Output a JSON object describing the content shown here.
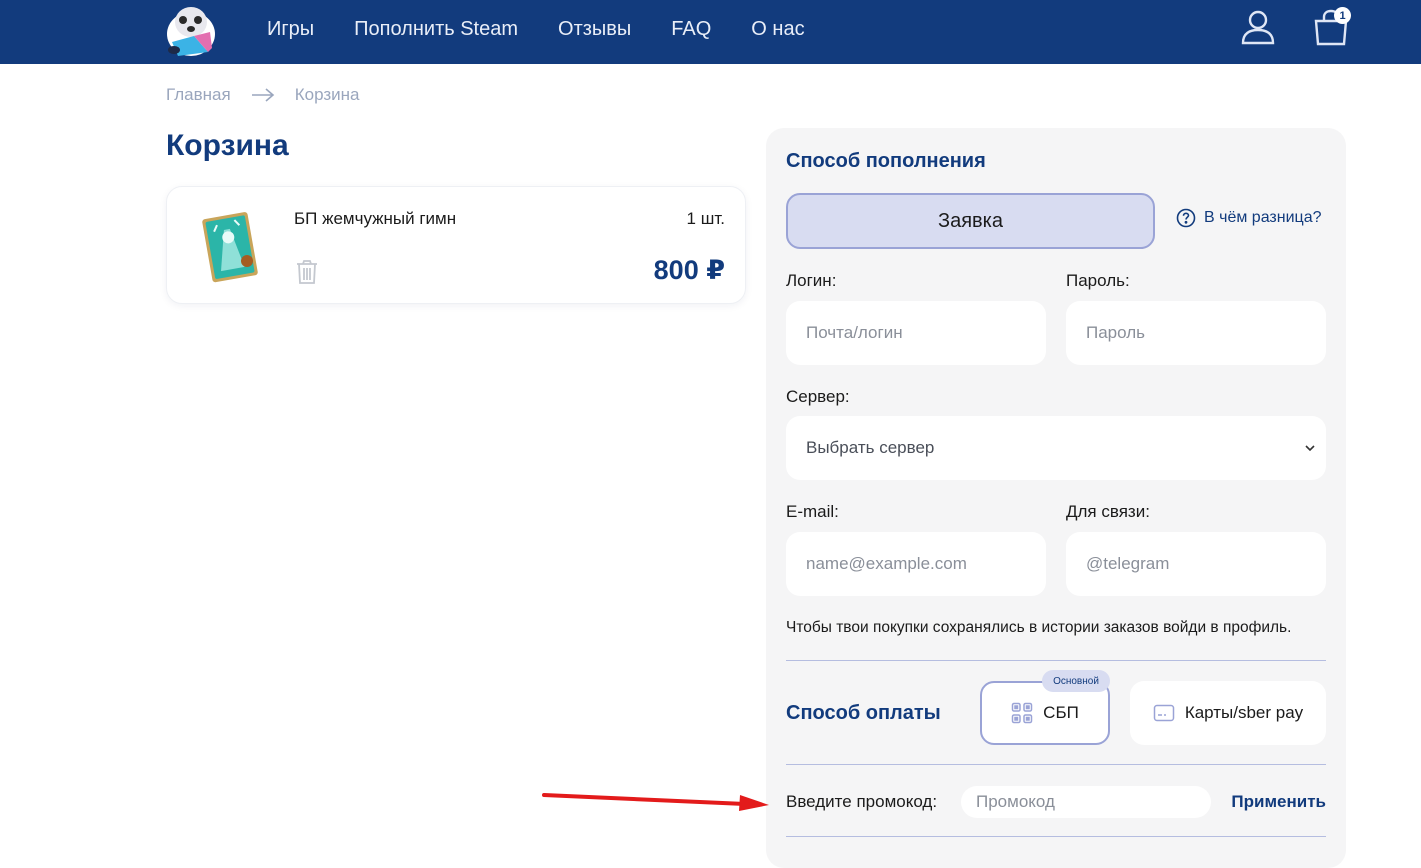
{
  "header": {
    "nav": [
      "Игры",
      "Пополнить Steam",
      "Отзывы",
      "FAQ",
      "О нас"
    ],
    "cart_count": "1",
    "icons": {
      "user": "user-icon",
      "cart": "shopping-bag-icon"
    },
    "colors": {
      "background": "#123b7d",
      "text": "#e9eef8"
    }
  },
  "breadcrumb": {
    "home": "Главная",
    "current": "Корзина"
  },
  "page_title": "Корзина",
  "cart_item": {
    "name": "БП жемчужный гимн",
    "quantity": "1 шт.",
    "price": "800 ₽"
  },
  "topup": {
    "title": "Способ пополнения",
    "method_button": "Заявка",
    "difference_link": "В чём разница?",
    "login_label": "Логин:",
    "login_placeholder": "Почта/логин",
    "password_label": "Пароль:",
    "password_placeholder": "Пароль",
    "server_label": "Сервер:",
    "server_selected": "Выбрать сервер",
    "email_label": "E-mail:",
    "email_placeholder": "name@example.com",
    "contact_label": "Для связи:",
    "contact_placeholder": "@telegram",
    "note": "Чтобы твои покупки сохранялись в истории заказов войди в профиль."
  },
  "payment": {
    "title": "Способ оплаты",
    "sbp_label": "СБП",
    "sbp_badge": "Основной",
    "card_label": "Карты/sber pay"
  },
  "promo": {
    "label": "Введите промокод:",
    "placeholder": "Промокод",
    "apply_label": "Применить"
  },
  "colors": {
    "brand": "#123b7d",
    "accent_light": "#d8dcf1",
    "panel_bg": "#f5f5f6",
    "annotation_arrow": "#e31b1b"
  }
}
